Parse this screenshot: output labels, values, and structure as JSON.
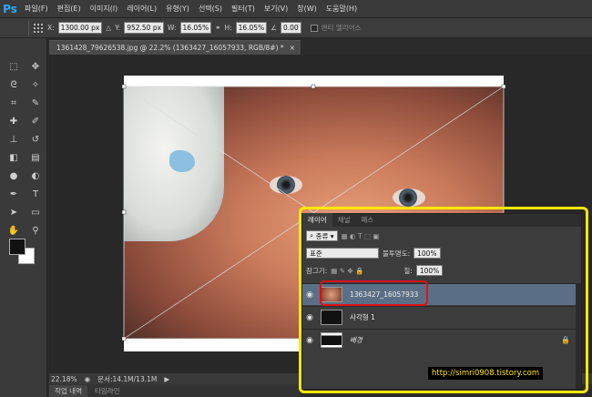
{
  "app": {
    "logo": "Ps"
  },
  "menu": [
    "파일(F)",
    "편집(E)",
    "이미지(I)",
    "레이어(L)",
    "유형(Y)",
    "선택(S)",
    "필터(T)",
    "보기(V)",
    "창(W)",
    "도움말(H)"
  ],
  "options": {
    "x_label": "X:",
    "x_value": "1300.00 px",
    "y_label": "Y:",
    "y_value": "952.50 px",
    "w_label": "W:",
    "w_value": "16.05%",
    "h_label": "H:",
    "h_value": "16.05%",
    "angle_value": "0.00",
    "antialias_label": "앤티 앨리어스"
  },
  "document": {
    "tab_title": "1361428_79626538.jpg @ 22.2% (1363427_16057933, RGB/8#) *",
    "zoom": "22.18%",
    "doc_info": "문서:14.1M/13.1M"
  },
  "bottom_tabs": [
    "작업 내역",
    "타임라인"
  ],
  "layers_panel": {
    "tabs": [
      "레이어",
      "채널",
      "패스"
    ],
    "filter_label": "종류",
    "blend_mode": "표준",
    "opacity_label": "불투명도:",
    "opacity_value": "100%",
    "lock_label": "잠그기:",
    "fill_label": "칠:",
    "fill_value": "100%",
    "layers": [
      {
        "name": "1363427_16057933",
        "selected": true
      },
      {
        "name": "사각형 1",
        "selected": false
      },
      {
        "name": "배경",
        "selected": false,
        "locked": true
      }
    ]
  },
  "watermark": "http://simri0908.tistory.com",
  "colors": {
    "highlight": "#ffe700",
    "selection_ring": "#e01010",
    "selected_layer": "#5a6f86"
  }
}
